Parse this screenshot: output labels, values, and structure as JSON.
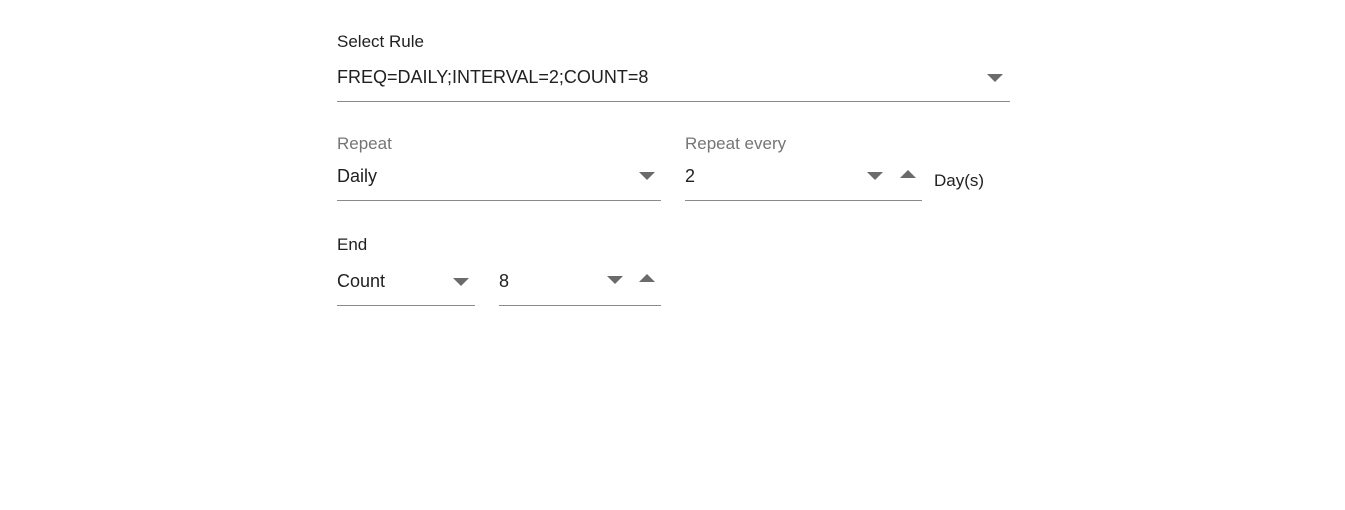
{
  "select_rule": {
    "label": "Select Rule",
    "value": "FREQ=DAILY;INTERVAL=2;COUNT=8"
  },
  "repeat": {
    "label": "Repeat",
    "value": "Daily"
  },
  "repeat_every": {
    "label": "Repeat every",
    "value": "2",
    "unit": "Day(s)"
  },
  "end": {
    "label": "End",
    "type_value": "Count",
    "count_value": "8"
  },
  "colors": {
    "text": "#212121",
    "muted": "#757575",
    "underline": "#8a8a8a",
    "icon": "#6b6b6b"
  }
}
